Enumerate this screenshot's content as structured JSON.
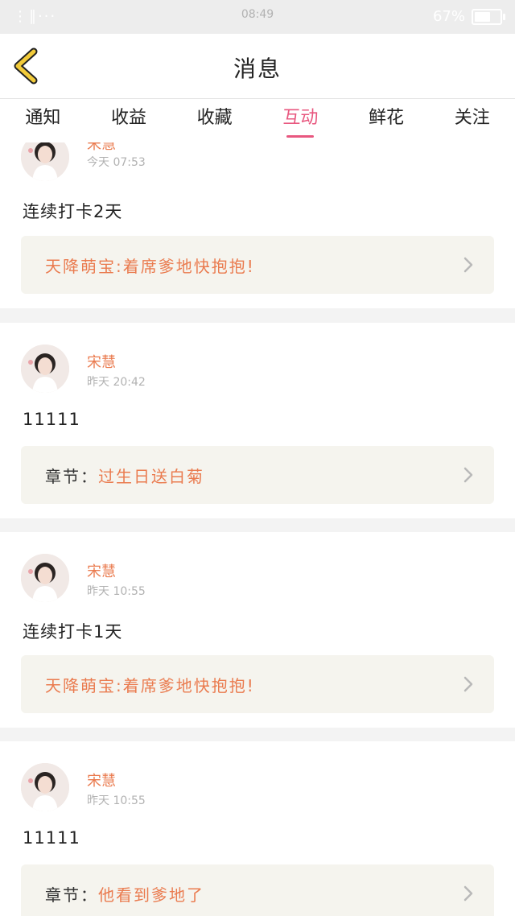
{
  "status_bar": {
    "left": "⋮∥···",
    "time": "08:49",
    "battery": "67%",
    "battery_level": 0.67
  },
  "header": {
    "title": "消息"
  },
  "tabs": [
    {
      "label": "通知",
      "active": false
    },
    {
      "label": "收益",
      "active": false
    },
    {
      "label": "收藏",
      "active": false
    },
    {
      "label": "互动",
      "active": true
    },
    {
      "label": "鲜花",
      "active": false
    },
    {
      "label": "关注",
      "active": false
    }
  ],
  "messages": [
    {
      "user": "宋慧",
      "time": "今天 07:53",
      "text": "连续打卡2天",
      "link_prefix": "",
      "link_text": "天降萌宝:着席爹地快抱抱!"
    },
    {
      "user": "宋慧",
      "time": "昨天 20:42",
      "text": "11111",
      "link_prefix": "章节：",
      "link_text": "过生日送白菊"
    },
    {
      "user": "宋慧",
      "time": "昨天 10:55",
      "text": "连续打卡1天",
      "link_prefix": "",
      "link_text": "天降萌宝:着席爹地快抱抱!"
    },
    {
      "user": "宋慧",
      "time": "昨天 10:55",
      "text": "11111",
      "link_prefix": "章节：",
      "link_text": "他看到爹地了"
    }
  ],
  "colors": {
    "accent": "#e8577f",
    "name_orange": "#ea7b4f",
    "back_yellow": "#f2cb3a",
    "link_bg": "#f5f4ee"
  }
}
